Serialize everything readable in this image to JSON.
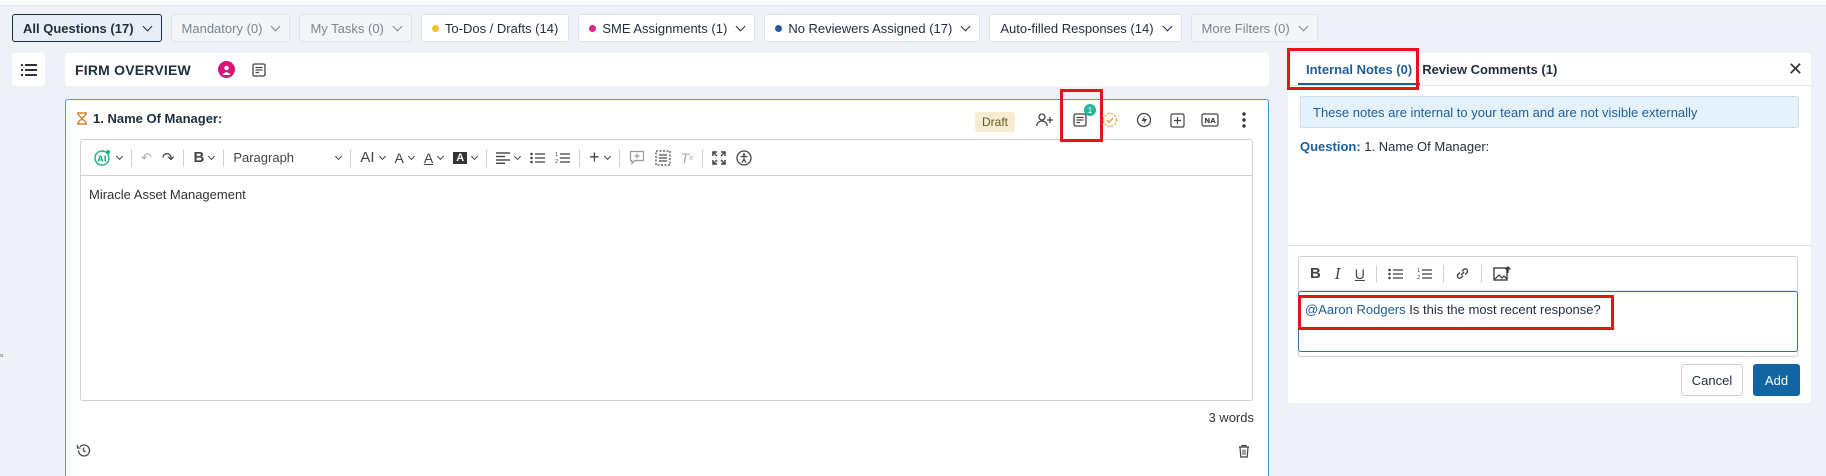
{
  "filters": [
    {
      "label": "All Questions (17)",
      "state": "active"
    },
    {
      "label": "Mandatory (0)",
      "state": "muted"
    },
    {
      "label": "My Tasks (0)",
      "state": "muted"
    },
    {
      "label": "To-Dos / Drafts (14)",
      "state": "normal",
      "dot": "#f2c12e"
    },
    {
      "label": "SME Assignments (1)",
      "state": "normal",
      "dot": "#e0248a"
    },
    {
      "label": "No Reviewers Assigned (17)",
      "state": "normal",
      "dot": "#2c5aa0"
    },
    {
      "label": "Auto-filled Responses (14)",
      "state": "normal"
    },
    {
      "label": "More Filters (0)",
      "state": "muted"
    }
  ],
  "section": {
    "title": "FIRM OVERVIEW"
  },
  "question": {
    "title": "1. Name Of Manager:",
    "status": "Draft",
    "notes_badge": "1",
    "answer_text": "Miracle Asset Management",
    "word_count": "3 words"
  },
  "toolbar": {
    "paragraph_label": "Paragraph"
  },
  "panel": {
    "tabs": [
      "Internal Notes (0)",
      "Review Comments (1)"
    ],
    "notice": "These notes are internal to your team and are not visible externally",
    "question_label": "Question:",
    "question_value": "1. Name Of Manager:",
    "mention": "@Aaron Rodgers",
    "note_text": " Is this the most recent response?",
    "cancel_label": "Cancel",
    "add_label": "Add"
  },
  "colors": {
    "accent": "#1264a3",
    "highlight": "#e2141c",
    "badge": "#25b89a"
  }
}
